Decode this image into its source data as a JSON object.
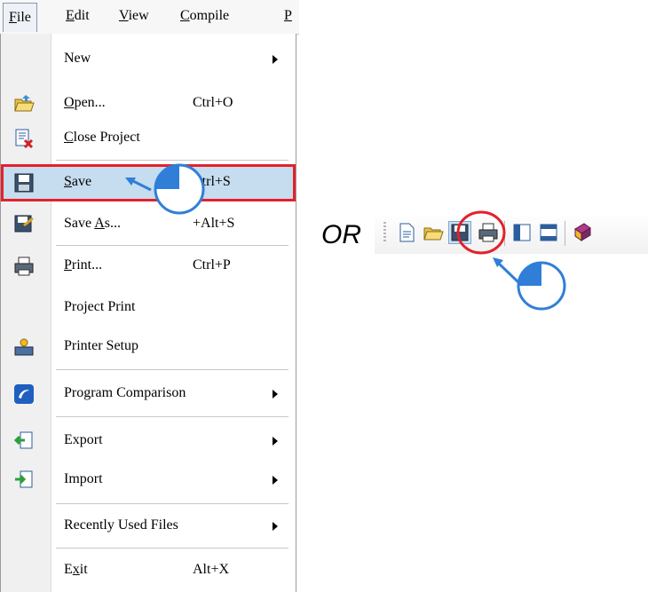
{
  "menubar": {
    "items": [
      {
        "label": "File",
        "u": "F",
        "rest": "ile"
      },
      {
        "label": "Edit",
        "u": "E",
        "rest": "dit"
      },
      {
        "label": "View",
        "u": "V",
        "rest": "iew"
      },
      {
        "label": "Compile",
        "u": "C",
        "rest": "ompile"
      },
      {
        "label": "P",
        "u": "P",
        "rest": ""
      }
    ]
  },
  "file_menu": {
    "new": {
      "label": "New"
    },
    "open": {
      "u": "O",
      "rest": "pen...",
      "shortcut": "Ctrl+O"
    },
    "close_project": {
      "u": "C",
      "rest": "lose Project"
    },
    "save": {
      "u": "S",
      "rest": "ave",
      "shortcut": "Ctrl+S"
    },
    "save_as": {
      "pre": "Save ",
      "u": "A",
      "rest": "s...",
      "shortcut": "+Alt+S"
    },
    "print": {
      "u": "P",
      "rest": "rint...",
      "shortcut": "Ctrl+P"
    },
    "project_print": {
      "label": "Project Print"
    },
    "printer_setup": {
      "label": "Printer Setup"
    },
    "program_comparison": {
      "label": "Program Comparison"
    },
    "export": {
      "label": "Export"
    },
    "import": {
      "label": "Import"
    },
    "recent": {
      "label": "Recently Used Files"
    },
    "exit": {
      "pre": "E",
      "u": "x",
      "rest": "it",
      "shortcut": "Alt+X"
    }
  },
  "or_label": "OR",
  "toolbar": {
    "buttons": [
      "new-file-icon",
      "open-folder-icon",
      "save-icon",
      "print-icon",
      "panel-icon",
      "window-icon",
      "book-icon"
    ]
  },
  "colors": {
    "highlight": "#c6dcef",
    "outline_red": "#e3212a",
    "arrow_blue": "#2f7fd8"
  }
}
